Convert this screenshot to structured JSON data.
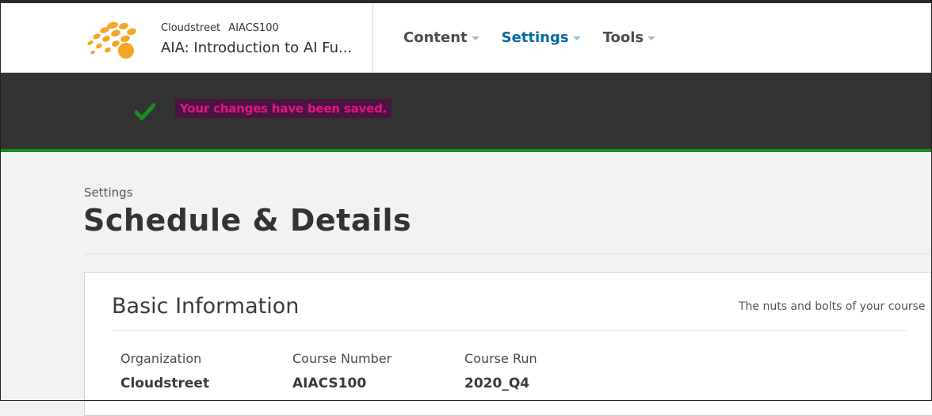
{
  "header": {
    "org": "Cloudstreet",
    "course_number": "AIACS100",
    "course_title": "AIA: Introduction to AI Fu...",
    "nav": [
      {
        "label": "Content"
      },
      {
        "label": "Settings"
      },
      {
        "label": "Tools"
      }
    ]
  },
  "alert": {
    "message": "Your changes have been saved.",
    "icon": "check-icon"
  },
  "page": {
    "breadcrumb": "Settings",
    "title": "Schedule & Details"
  },
  "basic_info": {
    "title": "Basic Information",
    "subtitle": "The nuts and bolts of your course",
    "fields": [
      {
        "label": "Organization",
        "value": "Cloudstreet"
      },
      {
        "label": "Course Number",
        "value": "AIACS100"
      },
      {
        "label": "Course Run",
        "value": "2020_Q4"
      }
    ]
  },
  "colors": {
    "accent": "#0a6aa1",
    "banner_bg": "#333333",
    "success_green": "#1a8c1a",
    "alert_text": "#e0157e",
    "logo_orange": "#f5a623"
  }
}
